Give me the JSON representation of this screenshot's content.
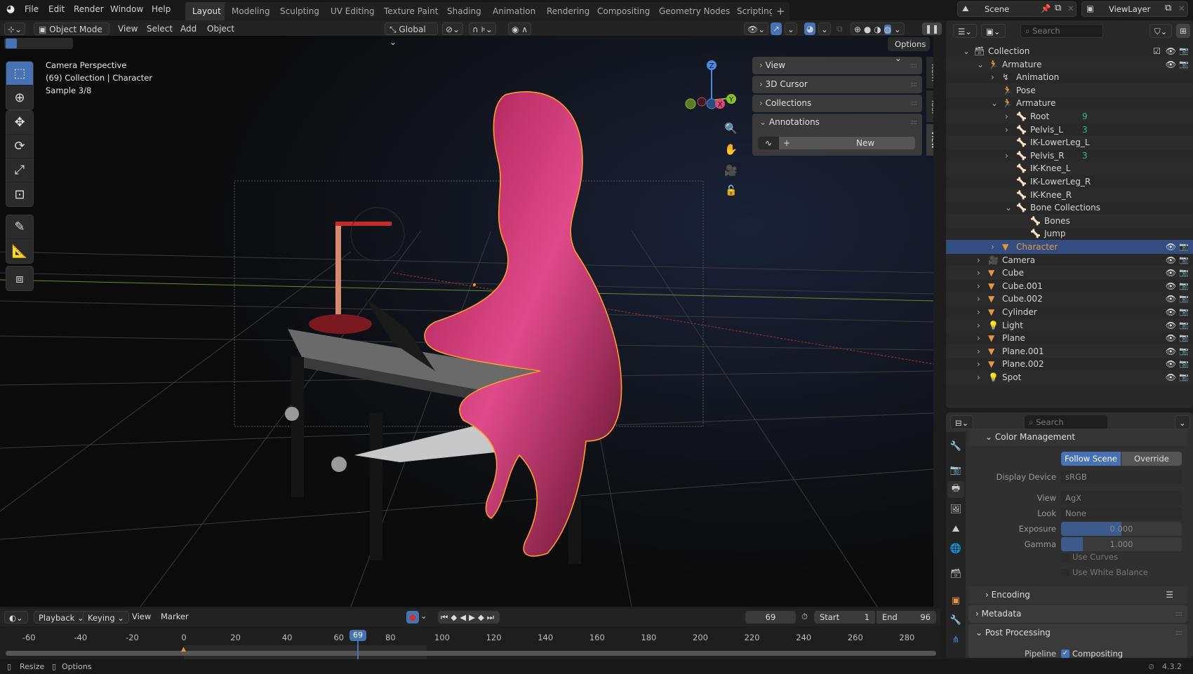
{
  "menu": {
    "items": [
      "File",
      "Edit",
      "Render",
      "Window",
      "Help"
    ]
  },
  "workspaces": {
    "tabs": [
      "Layout",
      "Modeling",
      "Sculpting",
      "UV Editing",
      "Texture Paint",
      "Shading",
      "Animation",
      "Rendering",
      "Compositing",
      "Geometry Nodes",
      "Scripting"
    ],
    "active": "Layout",
    "add_icon": "+"
  },
  "scene": {
    "name": "Scene",
    "view_layer": "ViewLayer"
  },
  "viewport_header": {
    "mode": "Object Mode",
    "menus": [
      "View",
      "Select",
      "Add",
      "Object"
    ],
    "orientation": "Global",
    "options": "Options"
  },
  "viewport_overlay": {
    "line1": "Camera Perspective",
    "line2": "(69) Collection | Character",
    "line3": "Sample 3/8"
  },
  "gizmo": {
    "axes": [
      "X",
      "Y",
      "Z"
    ]
  },
  "npanel": {
    "panels": [
      "View",
      "3D Cursor",
      "Collections",
      "Annotations"
    ],
    "annotations_button": "New",
    "tabs": [
      "Item",
      "Tool",
      "View"
    ],
    "active_tab": "View"
  },
  "timeline": {
    "menus": [
      "Playback",
      "Keying",
      "View",
      "Marker"
    ],
    "current_frame": "69",
    "start_label": "Start",
    "start": "1",
    "end_label": "End",
    "end": "96",
    "ticks": [
      "-60",
      "-40",
      "-20",
      "0",
      "20",
      "40",
      "60",
      "80",
      "100",
      "120",
      "140",
      "160",
      "180",
      "200",
      "220",
      "240",
      "260",
      "280"
    ]
  },
  "outliner": {
    "search_placeholder": "Search",
    "rows": [
      {
        "label": "Collection",
        "depth": 0,
        "icon": "collection"
      },
      {
        "label": "Armature",
        "depth": 1,
        "icon": "armature-object"
      },
      {
        "label": "Animation",
        "depth": 2,
        "icon": "animation"
      },
      {
        "label": "Pose",
        "depth": 2,
        "icon": "pose"
      },
      {
        "label": "Armature",
        "depth": 2,
        "icon": "armature-data"
      },
      {
        "label": "Root",
        "depth": 3,
        "icon": "bone",
        "badge": "9"
      },
      {
        "label": "Pelvis_L",
        "depth": 3,
        "icon": "bone",
        "badge": "3"
      },
      {
        "label": "IK-LowerLeg_L",
        "depth": 3,
        "icon": "bone"
      },
      {
        "label": "Pelvis_R",
        "depth": 3,
        "icon": "bone",
        "badge": "3"
      },
      {
        "label": "IK-Knee_L",
        "depth": 3,
        "icon": "bone"
      },
      {
        "label": "IK-LowerLeg_R",
        "depth": 3,
        "icon": "bone"
      },
      {
        "label": "IK-Knee_R",
        "depth": 3,
        "icon": "bone"
      },
      {
        "label": "Bone Collections",
        "depth": 3,
        "icon": "bone-collections"
      },
      {
        "label": "Bones",
        "depth": 4,
        "icon": "bone-collection"
      },
      {
        "label": "Jump",
        "depth": 4,
        "icon": "bone-collection"
      },
      {
        "label": "Character",
        "depth": 2,
        "icon": "mesh",
        "selected": true
      },
      {
        "label": "Camera",
        "depth": 1,
        "icon": "camera"
      },
      {
        "label": "Cube",
        "depth": 1,
        "icon": "mesh"
      },
      {
        "label": "Cube.001",
        "depth": 1,
        "icon": "mesh"
      },
      {
        "label": "Cube.002",
        "depth": 1,
        "icon": "mesh"
      },
      {
        "label": "Cylinder",
        "depth": 1,
        "icon": "mesh"
      },
      {
        "label": "Light",
        "depth": 1,
        "icon": "light"
      },
      {
        "label": "Plane",
        "depth": 1,
        "icon": "mesh"
      },
      {
        "label": "Plane.001",
        "depth": 1,
        "icon": "mesh"
      },
      {
        "label": "Plane.002",
        "depth": 1,
        "icon": "mesh"
      },
      {
        "label": "Spot",
        "depth": 1,
        "icon": "light"
      }
    ]
  },
  "properties": {
    "search_placeholder": "Search",
    "color_management": {
      "title": "Color Management",
      "toggle": [
        "Follow Scene",
        "Override"
      ],
      "active_toggle": "Follow Scene",
      "display_device_label": "Display Device",
      "display_device": "sRGB",
      "view_label": "View",
      "view": "AgX",
      "look_label": "Look",
      "look": "None",
      "exposure_label": "Exposure",
      "exposure": "0.000",
      "gamma_label": "Gamma",
      "gamma": "1.000",
      "use_curves": "Use Curves",
      "use_white_balance": "Use White Balance"
    },
    "encoding": "Encoding",
    "metadata": "Metadata",
    "post_processing": "Post Processing",
    "pipeline_label": "Pipeline",
    "compositing": "Compositing"
  },
  "statusbar": {
    "resize": "Resize",
    "options": "Options",
    "version": "4.3.2"
  },
  "colors": {
    "accent": "#4772b3",
    "selected_row": "#334d80",
    "object_orange": "#e8963f",
    "data_green": "#27c08a"
  }
}
